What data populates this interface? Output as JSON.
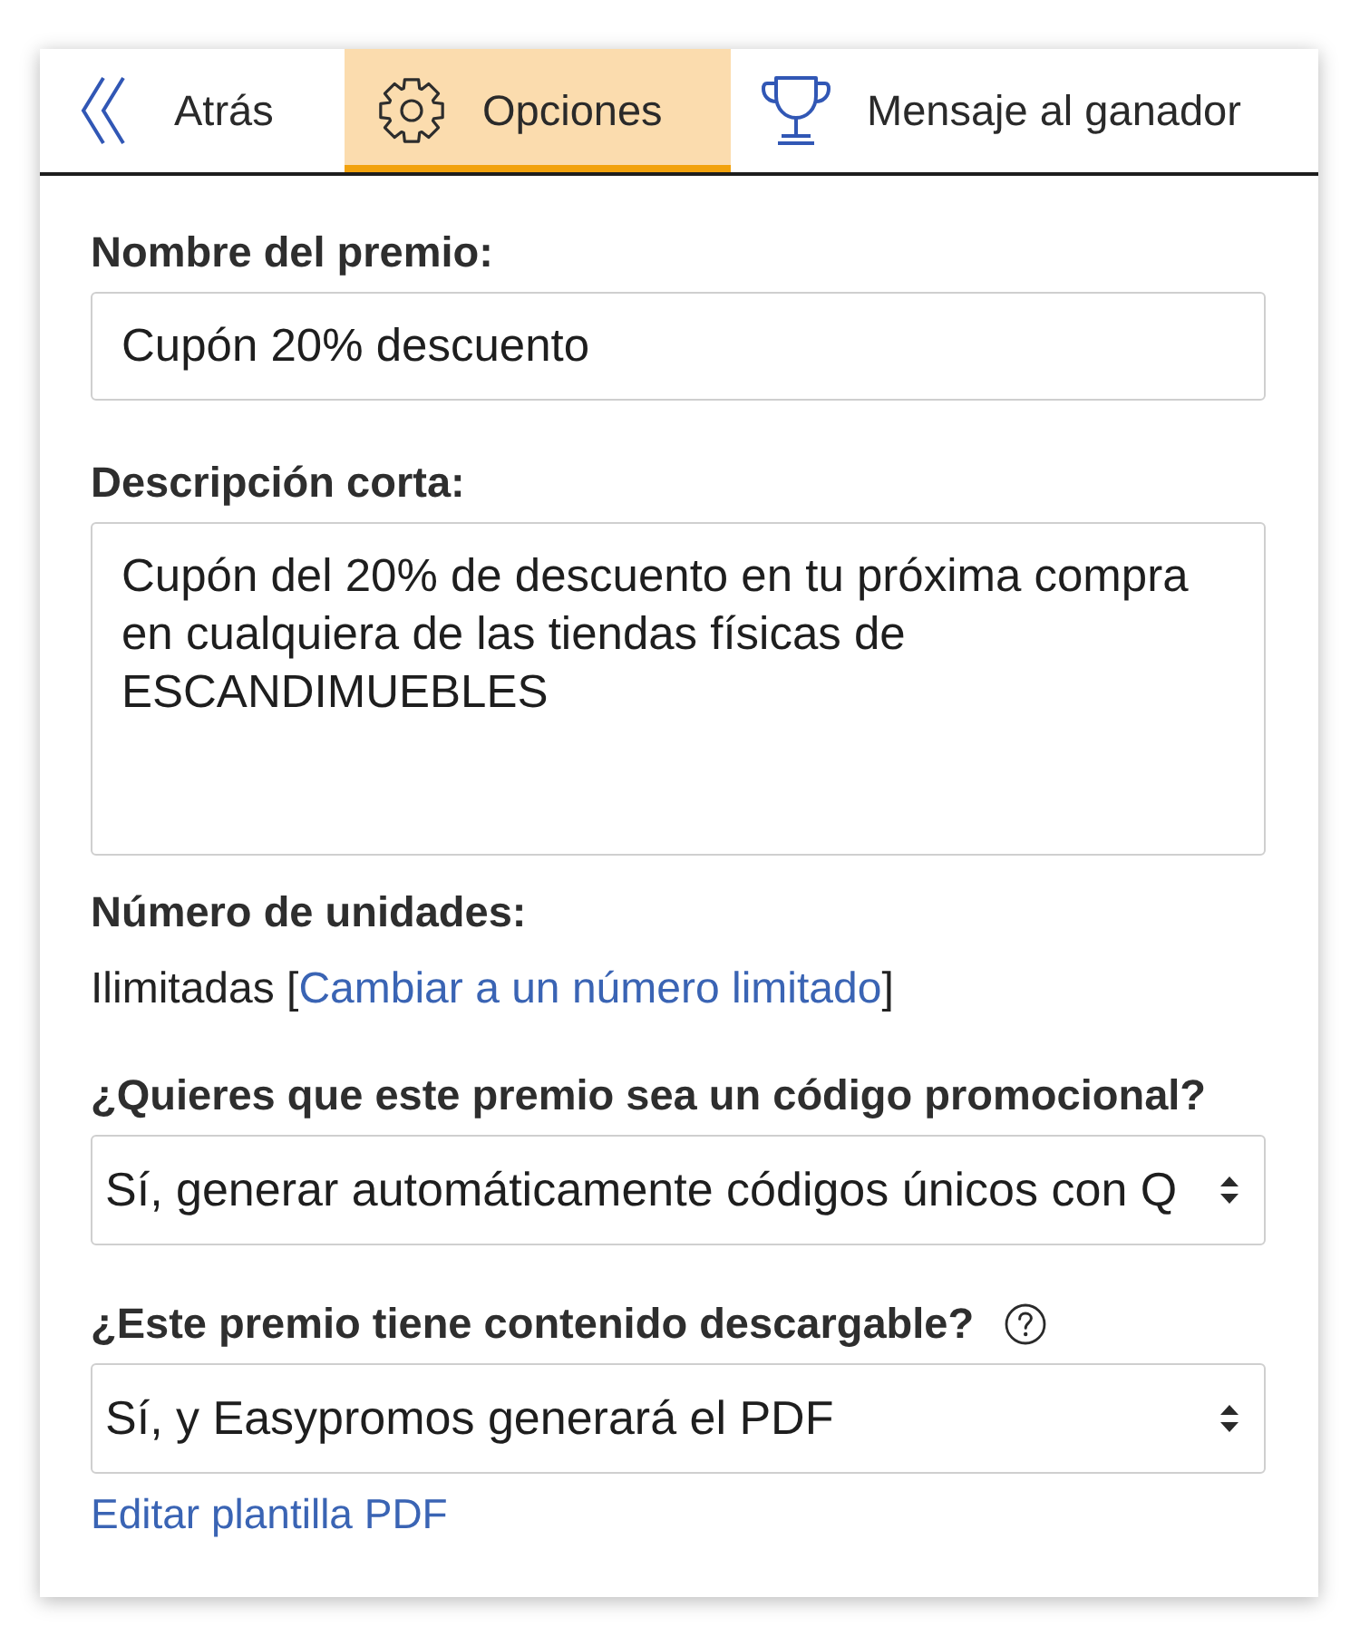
{
  "tabs": [
    {
      "kind": "back",
      "label": "Atrás",
      "selected": false
    },
    {
      "kind": "options",
      "label": "Opciones",
      "selected": true
    },
    {
      "kind": "message",
      "label": "Mensaje al ganador",
      "selected": false
    }
  ],
  "form": {
    "fields": [
      {
        "kind": "text",
        "label": "Nombre del premio:",
        "value": "Cupón 20% descuento"
      },
      {
        "kind": "textarea",
        "label": "Descripción corta:",
        "value": "Cupón del 20% de descuento en tu próxima compra en cualquiera de las tiendas físicas de ESCANDIMUEBLES"
      },
      {
        "kind": "units",
        "label": "Número de unidades:",
        "prefix": "Ilimitadas [",
        "link": "Cambiar a un número limitado",
        "suffix": "]"
      },
      {
        "kind": "select",
        "label": "¿Quieres que este premio sea un código promocional?",
        "value": "Sí, generar automáticamente códigos únicos con Q"
      },
      {
        "kind": "select",
        "label": "¿Este premio tiene contenido descargable?",
        "help": true,
        "value": "Sí, y Easypromos generará el PDF",
        "link": "Editar plantilla PDF"
      }
    ]
  }
}
